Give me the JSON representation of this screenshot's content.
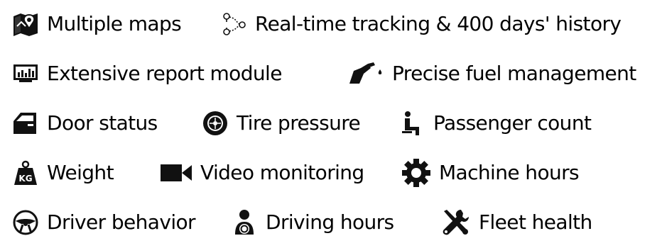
{
  "rows": [
    {
      "features": [
        {
          "label": "Multiple maps",
          "icon": "map-pin-icon"
        },
        {
          "label": "Real-time tracking & 400 days' history",
          "icon": "route-icon"
        }
      ]
    },
    {
      "features": [
        {
          "label": "Extensive report module",
          "icon": "report-monitor-icon"
        },
        {
          "label": "Precise fuel management",
          "icon": "fuel-nozzle-icon"
        }
      ]
    },
    {
      "features": [
        {
          "label": "Door status",
          "icon": "car-door-icon"
        },
        {
          "label": "Tire pressure",
          "icon": "tire-icon"
        },
        {
          "label": "Passenger count",
          "icon": "passenger-seat-icon"
        }
      ]
    },
    {
      "features": [
        {
          "label": "Weight",
          "icon": "weight-kg-icon",
          "icon_text": "KG"
        },
        {
          "label": "Video monitoring",
          "icon": "video-camera-icon"
        },
        {
          "label": "Machine hours",
          "icon": "gear-icon"
        }
      ]
    },
    {
      "features": [
        {
          "label": "Driver behavior",
          "icon": "steering-wheel-icon"
        },
        {
          "label": "Driving hours",
          "icon": "driver-icon"
        },
        {
          "label": "Fleet health",
          "icon": "wrench-screwdriver-icon"
        }
      ]
    }
  ]
}
